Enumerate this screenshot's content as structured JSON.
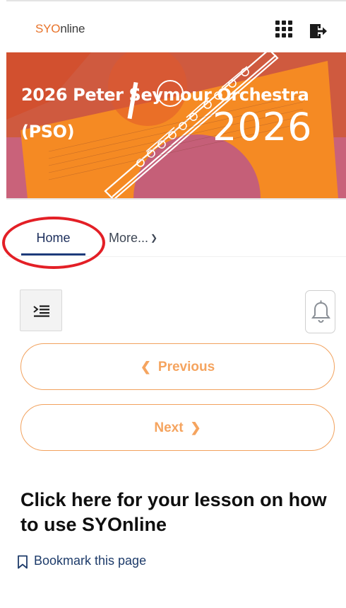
{
  "header": {
    "logo_prefix": "SYO",
    "logo_suffix": "nline",
    "apps_icon": "grid-icon",
    "logout_icon": "exit-icon"
  },
  "banner": {
    "title_line1": "2026 Peter Seymour Orchestra",
    "title_line2": "(PSO)",
    "year": "2026"
  },
  "tabs": {
    "home": "Home",
    "more": "More...",
    "more_icon": "chevron-down-icon"
  },
  "controls": {
    "drawer_icon": "indent-menu-icon",
    "bell_icon": "bell-icon"
  },
  "navigation": {
    "previous": "Previous",
    "next": "Next"
  },
  "content": {
    "lesson_heading": "Click here for your lesson on how to use SYOnline",
    "bookmark_label": "Bookmark this page"
  },
  "colors": {
    "accent_orange": "#f5a45f",
    "logo_orange": "#e8732a",
    "nav_blue": "#1d3b7a",
    "annotation_red": "#e31f26"
  }
}
